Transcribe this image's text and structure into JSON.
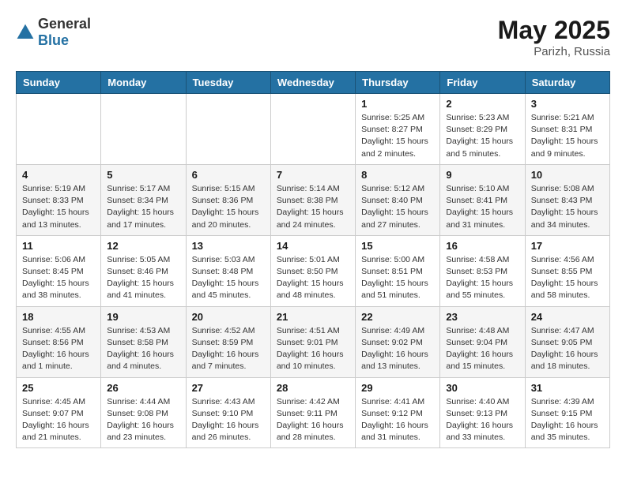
{
  "header": {
    "logo_general": "General",
    "logo_blue": "Blue",
    "title": "May 2025",
    "location": "Parizh, Russia"
  },
  "columns": [
    "Sunday",
    "Monday",
    "Tuesday",
    "Wednesday",
    "Thursday",
    "Friday",
    "Saturday"
  ],
  "weeks": [
    [
      {
        "day": "",
        "detail": ""
      },
      {
        "day": "",
        "detail": ""
      },
      {
        "day": "",
        "detail": ""
      },
      {
        "day": "",
        "detail": ""
      },
      {
        "day": "1",
        "detail": "Sunrise: 5:25 AM\nSunset: 8:27 PM\nDaylight: 15 hours\nand 2 minutes."
      },
      {
        "day": "2",
        "detail": "Sunrise: 5:23 AM\nSunset: 8:29 PM\nDaylight: 15 hours\nand 5 minutes."
      },
      {
        "day": "3",
        "detail": "Sunrise: 5:21 AM\nSunset: 8:31 PM\nDaylight: 15 hours\nand 9 minutes."
      }
    ],
    [
      {
        "day": "4",
        "detail": "Sunrise: 5:19 AM\nSunset: 8:33 PM\nDaylight: 15 hours\nand 13 minutes."
      },
      {
        "day": "5",
        "detail": "Sunrise: 5:17 AM\nSunset: 8:34 PM\nDaylight: 15 hours\nand 17 minutes."
      },
      {
        "day": "6",
        "detail": "Sunrise: 5:15 AM\nSunset: 8:36 PM\nDaylight: 15 hours\nand 20 minutes."
      },
      {
        "day": "7",
        "detail": "Sunrise: 5:14 AM\nSunset: 8:38 PM\nDaylight: 15 hours\nand 24 minutes."
      },
      {
        "day": "8",
        "detail": "Sunrise: 5:12 AM\nSunset: 8:40 PM\nDaylight: 15 hours\nand 27 minutes."
      },
      {
        "day": "9",
        "detail": "Sunrise: 5:10 AM\nSunset: 8:41 PM\nDaylight: 15 hours\nand 31 minutes."
      },
      {
        "day": "10",
        "detail": "Sunrise: 5:08 AM\nSunset: 8:43 PM\nDaylight: 15 hours\nand 34 minutes."
      }
    ],
    [
      {
        "day": "11",
        "detail": "Sunrise: 5:06 AM\nSunset: 8:45 PM\nDaylight: 15 hours\nand 38 minutes."
      },
      {
        "day": "12",
        "detail": "Sunrise: 5:05 AM\nSunset: 8:46 PM\nDaylight: 15 hours\nand 41 minutes."
      },
      {
        "day": "13",
        "detail": "Sunrise: 5:03 AM\nSunset: 8:48 PM\nDaylight: 15 hours\nand 45 minutes."
      },
      {
        "day": "14",
        "detail": "Sunrise: 5:01 AM\nSunset: 8:50 PM\nDaylight: 15 hours\nand 48 minutes."
      },
      {
        "day": "15",
        "detail": "Sunrise: 5:00 AM\nSunset: 8:51 PM\nDaylight: 15 hours\nand 51 minutes."
      },
      {
        "day": "16",
        "detail": "Sunrise: 4:58 AM\nSunset: 8:53 PM\nDaylight: 15 hours\nand 55 minutes."
      },
      {
        "day": "17",
        "detail": "Sunrise: 4:56 AM\nSunset: 8:55 PM\nDaylight: 15 hours\nand 58 minutes."
      }
    ],
    [
      {
        "day": "18",
        "detail": "Sunrise: 4:55 AM\nSunset: 8:56 PM\nDaylight: 16 hours\nand 1 minute."
      },
      {
        "day": "19",
        "detail": "Sunrise: 4:53 AM\nSunset: 8:58 PM\nDaylight: 16 hours\nand 4 minutes."
      },
      {
        "day": "20",
        "detail": "Sunrise: 4:52 AM\nSunset: 8:59 PM\nDaylight: 16 hours\nand 7 minutes."
      },
      {
        "day": "21",
        "detail": "Sunrise: 4:51 AM\nSunset: 9:01 PM\nDaylight: 16 hours\nand 10 minutes."
      },
      {
        "day": "22",
        "detail": "Sunrise: 4:49 AM\nSunset: 9:02 PM\nDaylight: 16 hours\nand 13 minutes."
      },
      {
        "day": "23",
        "detail": "Sunrise: 4:48 AM\nSunset: 9:04 PM\nDaylight: 16 hours\nand 15 minutes."
      },
      {
        "day": "24",
        "detail": "Sunrise: 4:47 AM\nSunset: 9:05 PM\nDaylight: 16 hours\nand 18 minutes."
      }
    ],
    [
      {
        "day": "25",
        "detail": "Sunrise: 4:45 AM\nSunset: 9:07 PM\nDaylight: 16 hours\nand 21 minutes."
      },
      {
        "day": "26",
        "detail": "Sunrise: 4:44 AM\nSunset: 9:08 PM\nDaylight: 16 hours\nand 23 minutes."
      },
      {
        "day": "27",
        "detail": "Sunrise: 4:43 AM\nSunset: 9:10 PM\nDaylight: 16 hours\nand 26 minutes."
      },
      {
        "day": "28",
        "detail": "Sunrise: 4:42 AM\nSunset: 9:11 PM\nDaylight: 16 hours\nand 28 minutes."
      },
      {
        "day": "29",
        "detail": "Sunrise: 4:41 AM\nSunset: 9:12 PM\nDaylight: 16 hours\nand 31 minutes."
      },
      {
        "day": "30",
        "detail": "Sunrise: 4:40 AM\nSunset: 9:13 PM\nDaylight: 16 hours\nand 33 minutes."
      },
      {
        "day": "31",
        "detail": "Sunrise: 4:39 AM\nSunset: 9:15 PM\nDaylight: 16 hours\nand 35 minutes."
      }
    ]
  ]
}
